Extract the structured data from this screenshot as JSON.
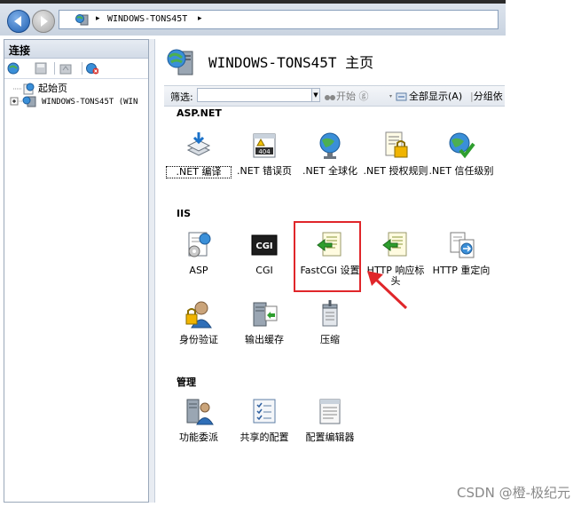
{
  "address_bar": {
    "crumb": "WINDOWS-TONS45T",
    "sep": "▸"
  },
  "connections": {
    "title": "连接",
    "tree": [
      {
        "label": "起始页"
      },
      {
        "label": "WINDOWS-TONS45T (WIN"
      }
    ]
  },
  "main": {
    "title": "WINDOWS-TONS45T 主页",
    "filter": {
      "label": "筛选:",
      "start": "开始 ⓖ",
      "show_all": "全部显示(A)",
      "group_by": "分组依"
    },
    "sections": [
      {
        "title": "ASP.NET",
        "items": [
          ".NET 编译",
          ".NET 错误页",
          ".NET 全球化",
          ".NET 授权规则",
          ".NET 信任级别"
        ]
      },
      {
        "title": "IIS",
        "items": [
          "ASP",
          "CGI",
          "FastCGI 设置",
          "HTTP 响应标头",
          "HTTP 重定向",
          "身份验证",
          "输出缓存",
          "压缩"
        ]
      },
      {
        "title": "管理",
        "items": [
          "功能委派",
          "共享的配置",
          "配置编辑器"
        ]
      }
    ]
  },
  "icons": {
    "cgi_badge": "CGI",
    "error_badge": "404"
  },
  "watermark": "CSDN @橙-极纪元",
  "colors": {
    "highlight": "#e0262a",
    "accent": "#1f5fb0"
  }
}
